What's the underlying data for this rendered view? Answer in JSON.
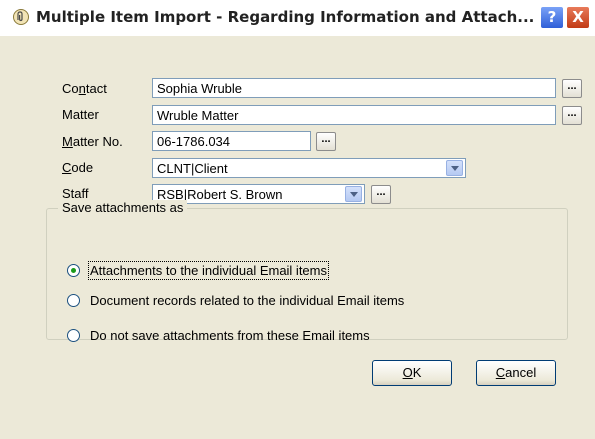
{
  "window": {
    "title": "Multiple Item Import - Regarding Information and Attach...",
    "icon": "paperclip-app-icon",
    "help_label": "?",
    "close_label": "X"
  },
  "fields": {
    "contact": {
      "label": "Contact",
      "value": "Sophia Wruble"
    },
    "matter": {
      "label": "Matter",
      "value": "Wruble Matter"
    },
    "matter_no": {
      "label": "Matter No.",
      "value": "06-1786.034"
    },
    "code": {
      "label": "Code",
      "value": "CLNT|Client"
    },
    "staff": {
      "label": "Staff",
      "value": "RSB|Robert S. Brown"
    },
    "ellipsis_label": "..."
  },
  "attachments": {
    "legend": "Save attachments as",
    "options": [
      {
        "label": "Attachments to the individual Email items",
        "selected": true
      },
      {
        "label": "Document records related to the individual Email items",
        "selected": false
      },
      {
        "label": "Do not save attachments from these Email items",
        "selected": false
      }
    ]
  },
  "buttons": {
    "ok": "OK",
    "cancel": "Cancel"
  }
}
